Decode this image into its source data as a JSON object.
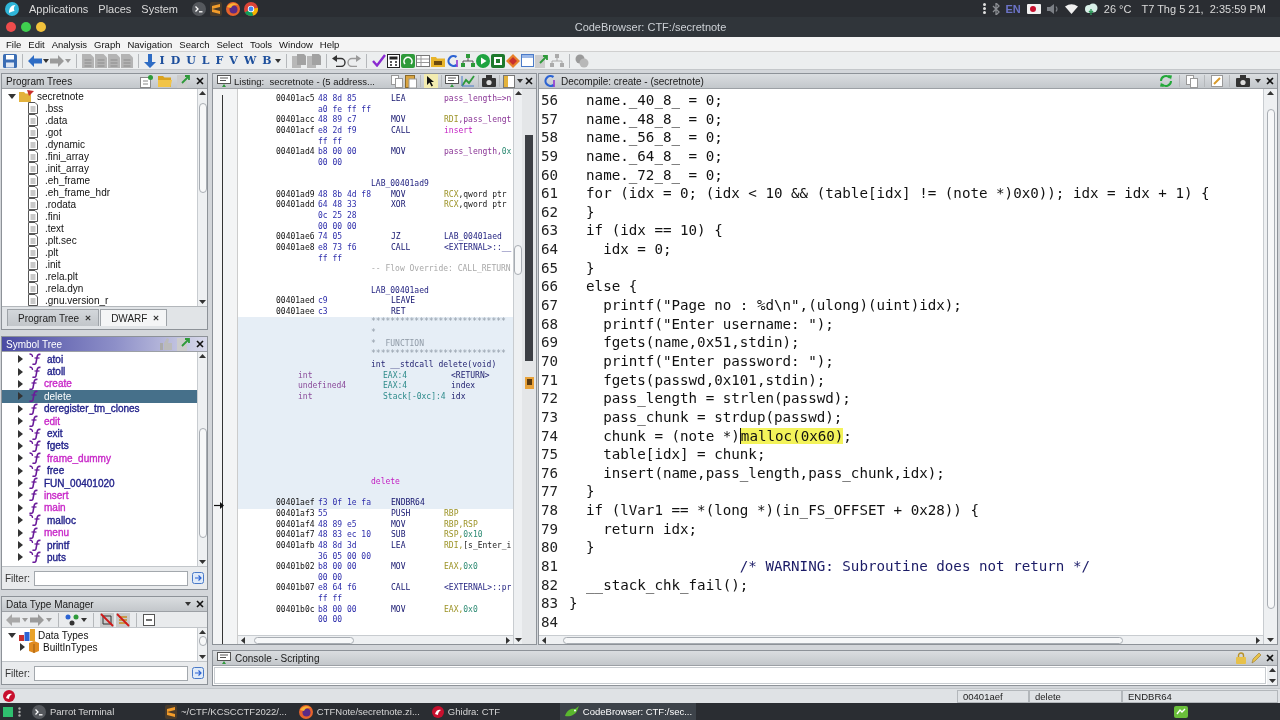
{
  "top_panel": {
    "menus": [
      "Applications",
      "Places",
      "System"
    ],
    "keyboard_layout": "EN",
    "temperature": "26 °C",
    "clock": "T7 Thg 5 21,  2:35:59 PM"
  },
  "window": {
    "title": "CodeBrowser: CTF:/secretnote"
  },
  "menu_bar": [
    "File",
    "Edit",
    "Analysis",
    "Graph",
    "Navigation",
    "Search",
    "Select",
    "Tools",
    "Window",
    "Help"
  ],
  "toolbar": {
    "navigation_letters": [
      "I",
      "D",
      "U",
      "L",
      "F",
      "V",
      "W",
      "B"
    ]
  },
  "program_trees": {
    "title": "Program Trees",
    "root": {
      "label": "secretnote",
      "expanded": true,
      "children": [
        {
          "label": ".bss"
        },
        {
          "label": ".data"
        },
        {
          "label": ".got"
        },
        {
          "label": ".dynamic"
        },
        {
          "label": ".fini_array"
        },
        {
          "label": ".init_array"
        },
        {
          "label": ".eh_frame"
        },
        {
          "label": ".eh_frame_hdr"
        },
        {
          "label": ".rodata"
        },
        {
          "label": ".fini"
        },
        {
          "label": ".text"
        },
        {
          "label": ".plt.sec"
        },
        {
          "label": ".plt"
        },
        {
          "label": ".init"
        },
        {
          "label": ".rela.plt"
        },
        {
          "label": ".rela.dyn"
        },
        {
          "label": ".gnu.version_r"
        }
      ]
    },
    "tabs": [
      {
        "label": "Program Tree",
        "selected": true
      },
      {
        "label": "DWARF",
        "selected": false
      }
    ]
  },
  "symbol_tree": {
    "title": "Symbol Tree",
    "items": [
      {
        "label": "atoi",
        "kind": "thunk",
        "color": "#22228a",
        "expanded": false,
        "selected": false
      },
      {
        "label": "atoll",
        "kind": "thunk",
        "color": "#22228a",
        "expanded": false,
        "selected": false
      },
      {
        "label": "create",
        "kind": "function",
        "color": "#c828c8",
        "expanded": false,
        "selected": false
      },
      {
        "label": "delete",
        "kind": "function",
        "expanded": false,
        "selected": true
      },
      {
        "label": "deregister_tm_clones",
        "kind": "function",
        "color": "#22228a",
        "expanded": false,
        "selected": false
      },
      {
        "label": "edit",
        "kind": "function",
        "color": "#c828c8",
        "expanded": false,
        "selected": false
      },
      {
        "label": "exit",
        "kind": "thunk",
        "color": "#22228a",
        "expanded": false,
        "selected": false
      },
      {
        "label": "fgets",
        "kind": "thunk",
        "color": "#22228a",
        "expanded": false,
        "selected": false
      },
      {
        "label": "frame_dummy",
        "kind": "thunk",
        "color": "#c828c8",
        "expanded": false,
        "selected": false
      },
      {
        "label": "free",
        "kind": "thunk",
        "color": "#22228a",
        "expanded": false,
        "selected": false
      },
      {
        "label": "FUN_00401020",
        "kind": "function",
        "color": "#22228a",
        "expanded": false,
        "selected": false
      },
      {
        "label": "insert",
        "kind": "function",
        "color": "#c828c8",
        "expanded": false,
        "selected": false
      },
      {
        "label": "main",
        "kind": "function",
        "color": "#c828c8",
        "expanded": false,
        "selected": false
      },
      {
        "label": "malloc",
        "kind": "thunk",
        "color": "#22228a",
        "expanded": false,
        "selected": false
      },
      {
        "label": "menu",
        "kind": "function",
        "color": "#c828c8",
        "expanded": false,
        "selected": false
      },
      {
        "label": "printf",
        "kind": "thunk",
        "color": "#22228a",
        "expanded": false,
        "selected": false
      },
      {
        "label": "puts",
        "kind": "thunk",
        "color": "#22228a",
        "expanded": false,
        "selected": false
      }
    ],
    "filter_label": "Filter:"
  },
  "data_type_manager": {
    "title": "Data Type Manager",
    "root": {
      "label": "Data Types",
      "expanded": true,
      "children": [
        {
          "label": "BuiltInTypes",
          "expanded": false
        }
      ]
    },
    "filter_label": "Filter:"
  },
  "listing": {
    "title": "Listing:  secretnote - (5 address...",
    "blocks": [
      {
        "shaded": false,
        "rows": [
          {
            "kind": "instruction",
            "address": "00401ac5",
            "bytes": "48 8d 85",
            "mnemonic": "LEA",
            "operand": [
              {
                "text": "pass_length=>n",
                "kind": "variable"
              }
            ]
          },
          {
            "kind": "bytes",
            "bytes": "a0 fe ff ff"
          },
          {
            "kind": "instruction",
            "address": "00401acc",
            "bytes": "48 89 c7",
            "mnemonic": "MOV",
            "operand": [
              {
                "text": "RDI",
                "kind": "register"
              },
              {
                "text": ",pass_lengt",
                "kind": "variable"
              }
            ]
          },
          {
            "kind": "instruction",
            "address": "00401acf",
            "bytes": "e8 2d f9",
            "mnemonic": "CALL",
            "operand": [
              {
                "text": "insert",
                "kind": "function"
              }
            ]
          },
          {
            "kind": "bytes",
            "bytes": "ff ff"
          },
          {
            "kind": "instruction",
            "address": "00401ad4",
            "bytes": "b8 00 00",
            "mnemonic": "MOV",
            "operand": [
              {
                "text": "pass_length,",
                "kind": "variable"
              },
              {
                "text": "0x",
                "kind": "scalar"
              }
            ]
          },
          {
            "kind": "bytes",
            "bytes": "00 00"
          },
          {
            "kind": "blank"
          },
          {
            "kind": "label",
            "text": "LAB_00401ad9"
          },
          {
            "kind": "instruction",
            "address": "00401ad9",
            "bytes": "48 8b 4d f8",
            "mnemonic": "MOV",
            "operand": [
              {
                "text": "RCX",
                "kind": "register"
              },
              {
                "text": ",qword ptr",
                "kind": "plain"
              }
            ]
          },
          {
            "kind": "instruction",
            "address": "00401add",
            "bytes": "64 48 33",
            "mnemonic": "XOR",
            "operand": [
              {
                "text": "RCX",
                "kind": "register"
              },
              {
                "text": ",qword ptr",
                "kind": "plain"
              }
            ]
          },
          {
            "kind": "bytes",
            "bytes": "0c 25 28"
          },
          {
            "kind": "bytes",
            "bytes": "00 00 00"
          },
          {
            "kind": "instruction",
            "address": "00401ae6",
            "bytes": "74 05",
            "mnemonic": "JZ",
            "operand": [
              {
                "text": "LAB_00401aed",
                "kind": "label"
              }
            ]
          },
          {
            "kind": "instruction",
            "address": "00401ae8",
            "bytes": "e8 73 f6",
            "mnemonic": "CALL",
            "operand": [
              {
                "text": "<EXTERNAL>::__",
                "kind": "label"
              }
            ]
          },
          {
            "kind": "bytes",
            "bytes": "ff ff"
          },
          {
            "kind": "flow-comment",
            "text": "-- Flow Override: CALL_RETURN"
          },
          {
            "kind": "blank"
          },
          {
            "kind": "label",
            "text": "LAB_00401aed"
          },
          {
            "kind": "instruction",
            "address": "00401aed",
            "bytes": "c9",
            "mnemonic": "LEAVE"
          },
          {
            "kind": "instruction",
            "address": "00401aee",
            "bytes": "c3",
            "mnemonic": "RET"
          }
        ]
      },
      {
        "shaded": true,
        "rows": [
          {
            "kind": "plate",
            "text": "****************************"
          },
          {
            "kind": "plate",
            "text": "*"
          },
          {
            "kind": "plate",
            "text": "*  FUNCTION"
          },
          {
            "kind": "plate",
            "text": "****************************"
          },
          {
            "kind": "signature",
            "text": "int __stdcall delete(void)"
          },
          {
            "kind": "parameter",
            "type": "int",
            "storage": "EAX:4",
            "name": "<RETURN>"
          },
          {
            "kind": "parameter",
            "type": "undefined4",
            "storage": "EAX:4",
            "name": "index"
          },
          {
            "kind": "parameter",
            "type": "int",
            "storage": "Stack[-0xc]:4",
            "name": "idx"
          },
          {
            "kind": "blank"
          },
          {
            "kind": "blank"
          },
          {
            "kind": "blank"
          },
          {
            "kind": "blank"
          },
          {
            "kind": "blank"
          },
          {
            "kind": "blank"
          },
          {
            "kind": "blank"
          },
          {
            "kind": "function-label",
            "text": "delete"
          },
          {
            "kind": "blank"
          },
          {
            "kind": "instruction",
            "address": "00401aef",
            "bytes": "f3 0f 1e fa",
            "mnemonic": "ENDBR64"
          }
        ]
      },
      {
        "shaded": false,
        "rows": [
          {
            "kind": "instruction",
            "address": "00401af3",
            "bytes": "55",
            "mnemonic": "PUSH",
            "operand": [
              {
                "text": "RBP",
                "kind": "register"
              }
            ]
          },
          {
            "kind": "instruction",
            "address": "00401af4",
            "bytes": "48 89 e5",
            "mnemonic": "MOV",
            "operand": [
              {
                "text": "RBP,RSP",
                "kind": "register"
              }
            ]
          },
          {
            "kind": "instruction",
            "address": "00401af7",
            "bytes": "48 83 ec 10",
            "mnemonic": "SUB",
            "operand": [
              {
                "text": "RSP,",
                "kind": "register"
              },
              {
                "text": "0x10",
                "kind": "scalar"
              }
            ]
          },
          {
            "kind": "instruction",
            "address": "00401afb",
            "bytes": "48 8d 3d",
            "mnemonic": "LEA",
            "operand": [
              {
                "text": "RDI,",
                "kind": "register"
              },
              {
                "text": "[s_Enter_i",
                "kind": "plain"
              }
            ]
          },
          {
            "kind": "bytes",
            "bytes": "36 05 00 00"
          },
          {
            "kind": "instruction",
            "address": "00401b02",
            "bytes": "b8 00 00",
            "mnemonic": "MOV",
            "operand": [
              {
                "text": "EAX,",
                "kind": "register"
              },
              {
                "text": "0x0",
                "kind": "scalar"
              }
            ]
          },
          {
            "kind": "bytes",
            "bytes": "00 00"
          },
          {
            "kind": "instruction",
            "address": "00401b07",
            "bytes": "e8 64 f6",
            "mnemonic": "CALL",
            "operand": [
              {
                "text": "<EXTERNAL>::pr",
                "kind": "label"
              }
            ]
          },
          {
            "kind": "bytes",
            "bytes": "ff ff"
          },
          {
            "kind": "instruction",
            "address": "00401b0c",
            "bytes": "b8 00 00",
            "mnemonic": "MOV",
            "operand": [
              {
                "text": "EAX,",
                "kind": "register"
              },
              {
                "text": "0x0",
                "kind": "scalar"
              }
            ]
          },
          {
            "kind": "bytes",
            "bytes": "00 00"
          }
        ]
      }
    ]
  },
  "decompiler": {
    "title": "Decompile: create - (secretnote)",
    "lines": [
      {
        "number": "56",
        "kind": "code",
        "text": "  name._40_8_ = 0;"
      },
      {
        "number": "57",
        "kind": "code",
        "text": "  name._48_8_ = 0;"
      },
      {
        "number": "58",
        "kind": "code",
        "text": "  name._56_8_ = 0;"
      },
      {
        "number": "59",
        "kind": "code",
        "text": "  name._64_8_ = 0;"
      },
      {
        "number": "60",
        "kind": "code",
        "text": "  name._72_8_ = 0;"
      },
      {
        "number": "61",
        "kind": "code",
        "text": "  for (idx = 0; (idx < 10 && (table[idx] != (note *)0x0)); idx = idx + 1) {"
      },
      {
        "number": "62",
        "kind": "code",
        "text": "  }"
      },
      {
        "number": "63",
        "kind": "code",
        "text": "  if (idx == 10) {"
      },
      {
        "number": "64",
        "kind": "code",
        "text": "    idx = 0;"
      },
      {
        "number": "65",
        "kind": "code",
        "text": "  }"
      },
      {
        "number": "66",
        "kind": "code",
        "text": "  else {"
      },
      {
        "number": "67",
        "kind": "code",
        "text": "    printf(\"Page no : %d\\n\",(ulong)(uint)idx);"
      },
      {
        "number": "68",
        "kind": "code",
        "text": "    printf(\"Enter username: \");"
      },
      {
        "number": "69",
        "kind": "code",
        "text": "    fgets(name,0x51,stdin);"
      },
      {
        "number": "70",
        "kind": "code",
        "text": "    printf(\"Enter password: \");"
      },
      {
        "number": "71",
        "kind": "code",
        "text": "    fgets(passwd,0x101,stdin);"
      },
      {
        "number": "72",
        "kind": "code",
        "text": "    pass_length = strlen(passwd);"
      },
      {
        "number": "73",
        "kind": "code",
        "text": "    pass_chunk = strdup(passwd);"
      },
      {
        "number": "74",
        "kind": "highlighted",
        "before": "    chunk = (note *)",
        "highlight": "malloc(0x60)",
        "after": ";"
      },
      {
        "number": "75",
        "kind": "code",
        "text": "    table[idx] = chunk;"
      },
      {
        "number": "76",
        "kind": "code",
        "text": "    insert(name,pass_length,pass_chunk,idx);"
      },
      {
        "number": "77",
        "kind": "code",
        "text": "  }"
      },
      {
        "number": "78",
        "kind": "code",
        "text": "  if (lVar1 == *(long *)(in_FS_OFFSET + 0x28)) {"
      },
      {
        "number": "79",
        "kind": "code",
        "text": "    return idx;"
      },
      {
        "number": "80",
        "kind": "code",
        "text": "  }"
      },
      {
        "number": "81",
        "kind": "comment",
        "text": "                    /* WARNING: Subroutine does not return */"
      },
      {
        "number": "82",
        "kind": "code",
        "text": "  __stack_chk_fail();"
      },
      {
        "number": "83",
        "kind": "code",
        "text": "}"
      },
      {
        "number": "84",
        "kind": "blank"
      }
    ]
  },
  "console": {
    "title": "Console - Scripting"
  },
  "status_bar": {
    "address": "00401aef",
    "function": "delete",
    "instruction": "ENDBR64"
  },
  "taskbar": {
    "items": [
      {
        "label": "Parrot Terminal",
        "kind": "terminal",
        "selected": false
      },
      {
        "label": "~/CTF/KCSCCTF2022/...",
        "kind": "editor",
        "selected": false
      },
      {
        "label": "CTFNote/secretnote.zi...",
        "kind": "browser",
        "selected": false
      },
      {
        "label": "Ghidra: CTF",
        "kind": "ghidra",
        "selected": false
      },
      {
        "label": "CodeBrowser: CTF:/sec...",
        "kind": "codebrowser",
        "selected": true
      }
    ]
  }
}
